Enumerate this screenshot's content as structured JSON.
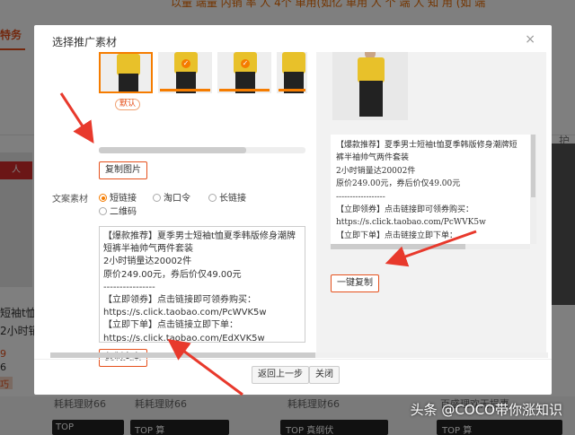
{
  "background": {
    "top_text": "以量 端量 内销 率 人 4个 单用(如亿 单用 人 个 端 人 知 用 (如 端",
    "left_tab": "特务",
    "left_card_label": "人",
    "right_label": "护",
    "left_text1": "短袖t恤",
    "left_text2": "2小时销量",
    "left_price1": "9",
    "left_price2": "6",
    "left_tag": "巧",
    "bottom_items": [
      "耗耗理财66",
      "耗耗理财66",
      "耗耗理财66",
      "百盛理欢无损事"
    ],
    "bottom_thumbs": [
      "TOP",
      "TOP 算",
      "TOP 真纲伏",
      "TOP 算"
    ]
  },
  "dialog": {
    "title": "选择推广素材",
    "close_symbol": "×",
    "default_badge": "默认",
    "copy_image_button": "复制图片",
    "copy_text_label": "文案素材",
    "radio_options": [
      {
        "label": "短链接",
        "checked": true
      },
      {
        "label": "淘口令",
        "checked": false
      },
      {
        "label": "长链接",
        "checked": false
      },
      {
        "label": "二维码",
        "checked": false
      }
    ],
    "text_content": "【爆款推荐】夏季男士短袖t恤夏季韩版修身潮牌短裤半袖帅气两件套装\n2小时销量达20002件\n原价249.00元，券后价仅49.00元\n----------------\n【立即领券】点击链接即可领券购买：https://s.click.taobao.com/PcWVK5w\n【立即下单】点击链接立即下单：https://s.click.taobao.com/EdXVK5w",
    "copy_text_button": "复制文案",
    "preview_text": "【爆款推荐】夏季男士短袖t恤夏季韩版修身潮牌短裤半袖帅气两件套装\n2小时销量达20002件\n原价249.00元，券后价仅49.00元\n------------------\n【立即领券】点击链接即可领券购买：https://s.click.taobao.com/PcWVK5w\n【立即下单】点击链接立即下单：https://s.click.taobao.com/EdXVK5w",
    "one_click_copy_button": "一键复制",
    "back_button": "返回上一步",
    "close_button": "关闭"
  },
  "watermark": "头条 @COCO带你涨知识",
  "colors": {
    "accent": "#e5511d",
    "check": "#f57c00",
    "arrow": "#e8392c"
  }
}
